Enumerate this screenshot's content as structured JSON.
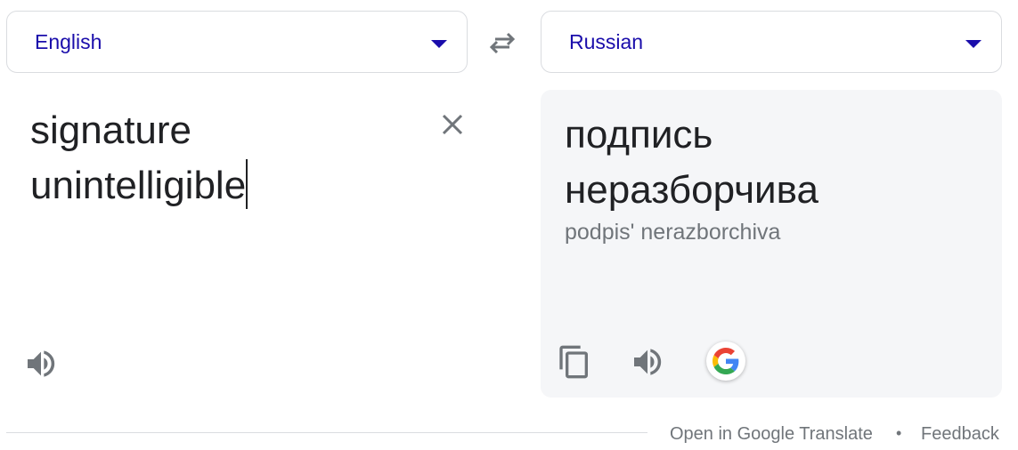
{
  "source_language": {
    "label": "English"
  },
  "target_language": {
    "label": "Russian"
  },
  "source_text": {
    "lines": [
      "signature",
      "unintelligible"
    ]
  },
  "translation": {
    "lines": [
      "подпись",
      "неразборчива"
    ],
    "transliteration": "podpis' nerazborchiva"
  },
  "icons": {
    "swap": "swap-arrows-icon",
    "clear": "close-icon",
    "speak": "speaker-icon",
    "copy": "copy-icon",
    "google": "google-g-icon"
  },
  "footer": {
    "open_link": "Open in Google Translate",
    "separator": "•",
    "feedback_link": "Feedback"
  },
  "colors": {
    "link": "#1a0dab",
    "text": "#202124",
    "muted": "#70757a",
    "result_bg": "#f5f6f8",
    "border": "#dadce0"
  }
}
